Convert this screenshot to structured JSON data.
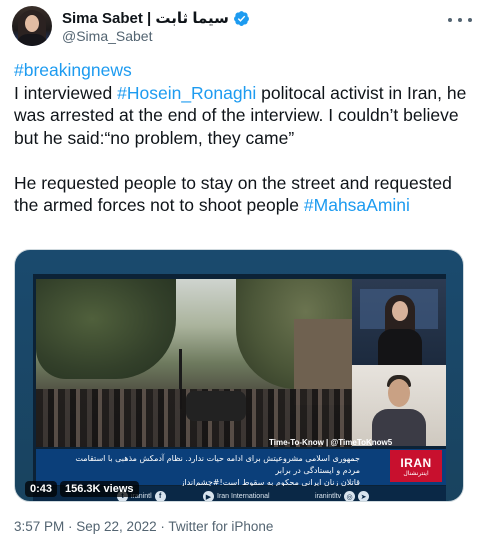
{
  "author": {
    "display_name": "Sima Sabet | سیما ثابت",
    "handle": "@Sima_Sabet",
    "verified": true
  },
  "tweet": {
    "hashtag_top": "#breakingnews",
    "line1_prefix": "I interviewed ",
    "mention_tag": "#Hosein_Ronaghi",
    "line1_suffix": " politocal activist in Iran, he was arrested at the end of the interview. I couldn’t believe but he said:“no problem, they came”",
    "paragraph2": "He requested people to stay on the street and requested the armed forces not to shoot people ",
    "hashtag_bottom": "#MahsaAmini"
  },
  "video": {
    "duration": "0:43",
    "views": "156.3K views",
    "overlay_channel": "Time-To-Know  |  @TimeToKnow5",
    "ticker_line1": "جمهوری اسلامی مشروعیتش برای ادامه حیات ندارد. نظام آدمکش مذهبی با استقامت مردم و ایستادگی در برابر",
    "ticker_line2": "قاتلان زنان ایرانی محکوم به سقوط است!#چشم‌انداز",
    "logo_big": "IRAN",
    "logo_small": "اینترنشنال",
    "social": [
      {
        "icon": "twitter-icon",
        "glyph": "t",
        "label": "iranintl"
      },
      {
        "icon": "facebook-icon",
        "glyph": "f",
        "label": ""
      },
      {
        "icon": "youtube-icon",
        "glyph": "▶",
        "label": "Iran International"
      },
      {
        "icon": "instagram-icon",
        "glyph": "◎",
        "label": "iranintltv"
      },
      {
        "icon": "telegram-icon",
        "glyph": "➤",
        "label": ""
      }
    ]
  },
  "meta": {
    "timestamp": "3:57 PM · Sep 22, 2022 · Twitter for iPhone"
  },
  "colors": {
    "link": "#1d9bf0",
    "verified": "#1d9bf0",
    "secondary_text": "#536471"
  }
}
